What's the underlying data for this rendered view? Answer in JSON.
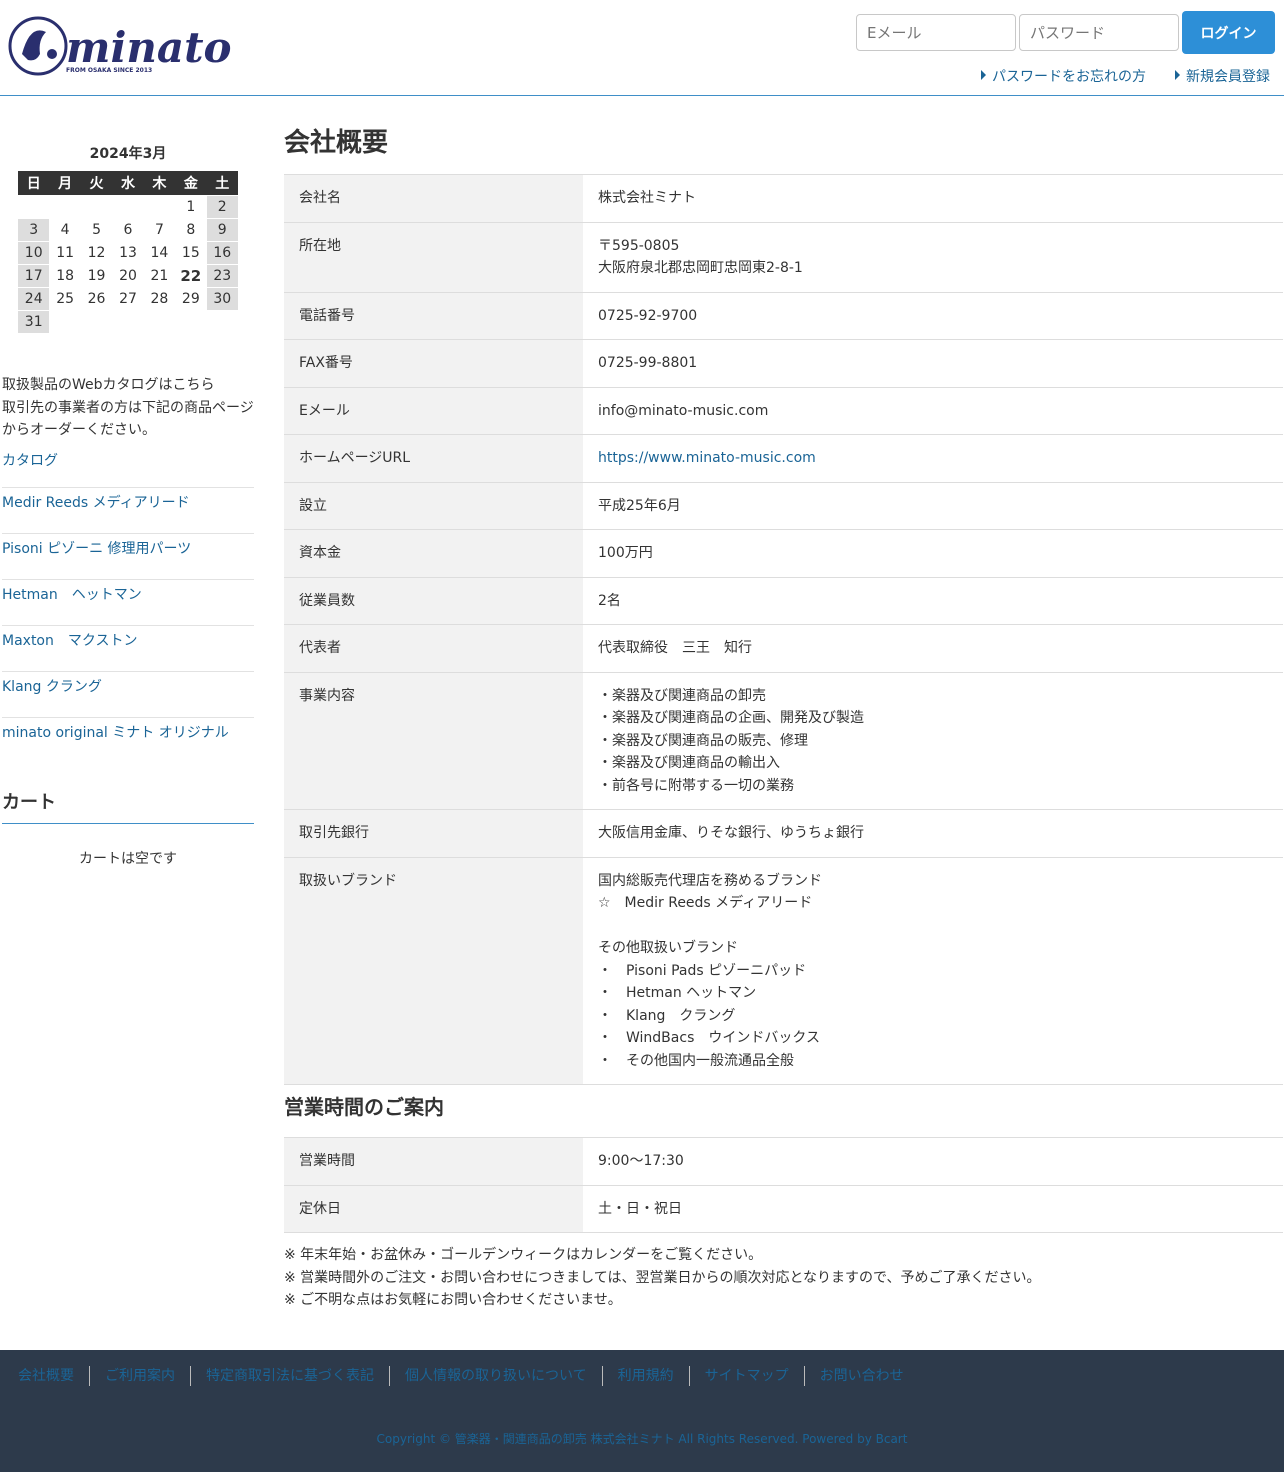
{
  "header": {
    "logo_text": "minato",
    "logo_tagline": "FROM OSAKA SINCE 2013",
    "email_placeholder": "Eメール",
    "password_placeholder": "パスワード",
    "login_label": "ログイン",
    "forgot_label": "パスワードをお忘れの方",
    "register_label": "新規会員登録"
  },
  "calendar": {
    "title": "2024年3月",
    "weekdays": [
      "日",
      "月",
      "火",
      "水",
      "木",
      "金",
      "土"
    ],
    "weeks": [
      [
        "",
        "",
        "",
        "",
        "",
        "1",
        "2"
      ],
      [
        "3",
        "4",
        "5",
        "6",
        "7",
        "8",
        "9"
      ],
      [
        "10",
        "11",
        "12",
        "13",
        "14",
        "15",
        "16"
      ],
      [
        "17",
        "18",
        "19",
        "20",
        "21",
        "22",
        "23"
      ],
      [
        "24",
        "25",
        "26",
        "27",
        "28",
        "29",
        "30"
      ],
      [
        "31",
        "",
        "",
        "",
        "",
        "",
        ""
      ]
    ],
    "today": "22"
  },
  "sidebar": {
    "intro_line1": "取扱製品のWebカタログはこちら",
    "intro_line2": "取引先の事業者の方は下記の商品ページからオーダーください。",
    "links": [
      "カタログ",
      "Medir Reeds メディアリード",
      "Pisoni ピゾーニ 修理用パーツ",
      "Hetman　ヘットマン",
      "Maxton　マクストン",
      "Klang クラング",
      "minato original ミナト オリジナル"
    ],
    "cart_title": "カート",
    "cart_empty": "カートは空です"
  },
  "main": {
    "title": "会社概要",
    "company_rows": [
      {
        "label": "会社名",
        "value": "株式会社ミナト"
      },
      {
        "label": "所在地",
        "value": "〒595-0805\n大阪府泉北郡忠岡町忠岡東2-8-1"
      },
      {
        "label": "電話番号",
        "value": "0725-92-9700"
      },
      {
        "label": "FAX番号",
        "value": "0725-99-8801"
      },
      {
        "label": "Eメール",
        "value": "info@minato-music.com"
      },
      {
        "label": "ホームページURL",
        "value": "https://www.minato-music.com",
        "link": true
      },
      {
        "label": "設立",
        "value": "平成25年6月"
      },
      {
        "label": "資本金",
        "value": "100万円"
      },
      {
        "label": "従業員数",
        "value": "2名"
      },
      {
        "label": "代表者",
        "value": "代表取締役　三王　知行"
      },
      {
        "label": "事業内容",
        "value": "・楽器及び関連商品の卸売\n・楽器及び関連商品の企画、開発及び製造\n・楽器及び関連商品の販売、修理\n・楽器及び関連商品の輸出入\n・前各号に附帯する一切の業務"
      },
      {
        "label": "取引先銀行",
        "value": "大阪信用金庫、りそな銀行、ゆうちょ銀行"
      },
      {
        "label": "取扱いブランド",
        "value": "国内総販売代理店を務めるブランド\n☆　Medir Reeds メディアリード\n\nその他取扱いブランド\n・　Pisoni Pads ピゾーニパッド\n・　Hetman ヘットマン\n・　Klang　クラング\n・　WindBacs　ウインドバックス\n・　その他国内一般流通品全般"
      }
    ],
    "hours_title": "営業時間のご案内",
    "hours_rows": [
      {
        "label": "営業時間",
        "value": "9:00〜17:30"
      },
      {
        "label": "定休日",
        "value": "土・日・祝日"
      }
    ],
    "notes": [
      "※ 年末年始・お盆休み・ゴールデンウィークはカレンダーをご覧ください。",
      "※ 営業時間外のご注文・お問い合わせにつきましては、翌営業日からの順次対応となりますので、予めご了承ください。",
      "※ ご不明な点はお気軽にお問い合わせくださいませ。"
    ]
  },
  "footer": {
    "links": [
      "会社概要",
      "ご利用案内",
      "特定商取引法に基づく表記",
      "個人情報の取り扱いについて",
      "利用規約",
      "サイトマップ",
      "お問い合わせ"
    ],
    "copyright": "Copyright © 管楽器・関連商品の卸売 株式会社ミナト All Rights Reserved. Powered by Bcart"
  },
  "colors": {
    "accent": "#2d8fd7",
    "link": "#1a6496",
    "footer_bg": "#2d3a4b"
  }
}
